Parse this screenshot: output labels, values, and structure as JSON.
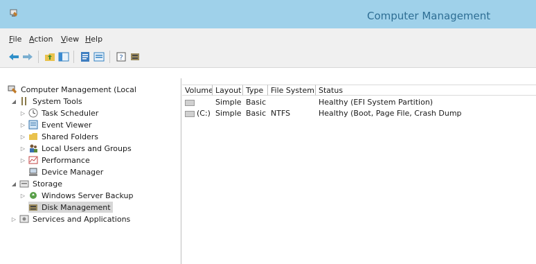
{
  "window": {
    "title": "Computer Management"
  },
  "menu": [
    {
      "label": "File",
      "mnemonic": "F"
    },
    {
      "label": "Action",
      "mnemonic": "A"
    },
    {
      "label": "View",
      "mnemonic": "V"
    },
    {
      "label": "Help",
      "mnemonic": "H"
    }
  ],
  "toolbar": {
    "buttons": [
      "back-arrow-icon",
      "forward-arrow-icon",
      "up-folder-icon",
      "show-hide-tree-icon",
      "properties-icon",
      "export-list-icon",
      "help-icon",
      "disk-icon"
    ]
  },
  "tree": {
    "root": "Computer Management (Local",
    "system_tools": "System Tools",
    "task_scheduler": "Task Scheduler",
    "event_viewer": "Event Viewer",
    "shared_folders": "Shared Folders",
    "local_users": "Local Users and Groups",
    "performance": "Performance",
    "device_manager": "Device Manager",
    "storage": "Storage",
    "windows_server_backup": "Windows Server Backup",
    "disk_management": "Disk Management",
    "services_apps": "Services and Applications"
  },
  "table": {
    "columns": [
      "Volume",
      "Layout",
      "Type",
      "File System",
      "Status"
    ],
    "rows": [
      {
        "volume": "",
        "layout": "Simple",
        "type": "Basic",
        "fs": "",
        "status": "Healthy (EFI System Partition)"
      },
      {
        "volume": "(C:)",
        "layout": "Simple",
        "type": "Basic",
        "fs": "NTFS",
        "status": "Healthy (Boot, Page File, Crash Dump"
      }
    ]
  },
  "colors": {
    "titlebar": "#9fd1ea",
    "title_text": "#2e6e94",
    "selection": "#d7d7d7"
  }
}
